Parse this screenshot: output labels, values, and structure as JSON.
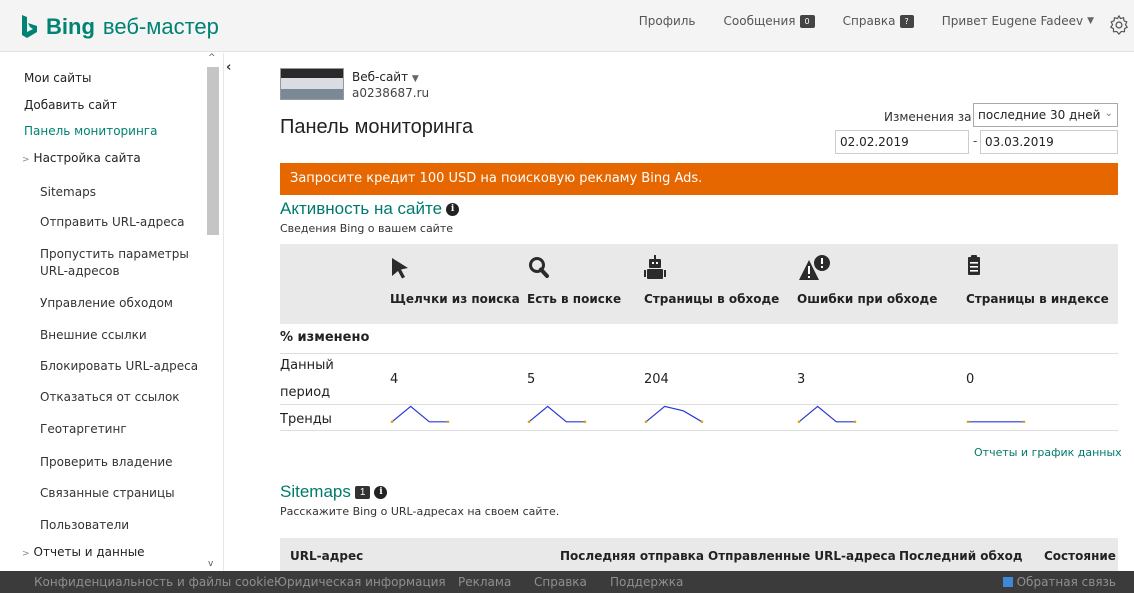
{
  "header": {
    "logo_text": "Bing",
    "logo_sub": "веб-мастер",
    "nav": [
      {
        "label": "Профиль"
      },
      {
        "label": "Сообщения",
        "badge": "0"
      },
      {
        "label": "Справка",
        "badge": "?"
      },
      {
        "label": "Привет Eugene Fadeev"
      }
    ],
    "settings_icon": "gear-icon"
  },
  "sidebar": {
    "items": [
      {
        "label": "Мои сайты"
      },
      {
        "label": "Добавить сайт"
      },
      {
        "label": "Панель мониторинга",
        "active": true
      },
      {
        "label": "Настройка сайта"
      },
      {
        "label": "Sitemaps"
      },
      {
        "label": "Отправить URL-адреса"
      },
      {
        "label": "Пропустить параметры"
      },
      {
        "label": "URL-адресов"
      },
      {
        "label": "Управление обходом"
      },
      {
        "label": "Внешние ссылки"
      },
      {
        "label": "Блокировать URL-адреса"
      },
      {
        "label": "Отказаться от ссылок"
      },
      {
        "label": "Геотаргетинг"
      },
      {
        "label": "Проверить владение"
      },
      {
        "label": "Связанные страницы"
      },
      {
        "label": "Пользователи"
      },
      {
        "label": "Отчеты и данные"
      }
    ]
  },
  "site": {
    "selector_label": "Веб-сайт",
    "url": "a0238687.ru"
  },
  "page": {
    "title": "Панель мониторинга",
    "change_label": "Изменения за",
    "period_selected": "последние 30 дней",
    "date_from": "02.02.2019",
    "date_sep": "-",
    "date_to": "03.03.2019"
  },
  "promo": {
    "text": "Запросите кредит 100 USD на поисковую рекламу Bing Ads."
  },
  "activity": {
    "title": "Активность на сайте",
    "subtitle": "Сведения Bing о вашем сайте",
    "metrics": [
      {
        "label": "Щелчки из поиска",
        "icon": "cursor-icon",
        "value": "4",
        "trend": [
          0.9,
          0.2,
          0.9,
          0.9
        ]
      },
      {
        "label": "Есть в поиске",
        "icon": "search-icon",
        "value": "5",
        "trend": [
          0.9,
          0.2,
          0.9,
          0.9
        ]
      },
      {
        "label": "Страницы в обходе",
        "icon": "robot-icon",
        "value": "204",
        "trend": [
          0.9,
          0.2,
          0.4,
          0.9
        ]
      },
      {
        "label": "Ошибки при обходе",
        "icon": "robot-error-icon",
        "value": "3",
        "trend": [
          0.9,
          0.2,
          0.9,
          0.9
        ]
      },
      {
        "label": "Страницы в индексе",
        "icon": "document-icon",
        "value": "0",
        "trend": [
          0.9,
          0.9,
          0.9,
          0.9
        ]
      }
    ],
    "row_change": "% изменено",
    "row_period_1": "Данный",
    "row_period_2": "период",
    "row_trends": "Тренды",
    "reports_link": "Отчеты и график данных"
  },
  "sitemaps": {
    "title": "Sitemaps",
    "count": "1",
    "subtitle": "Расскажите Bing о URL-адресах на своем сайте.",
    "columns": [
      "URL-адрес",
      "Последняя отправка",
      "Отправленные URL-адреса",
      "Последний обход",
      "Состояние"
    ]
  },
  "footer": {
    "links": [
      "Конфиденциальность и файлы cookie",
      "Юридическая информация",
      "Реклама",
      "Справка",
      "Поддержка"
    ],
    "feedback": "Обратная связь"
  },
  "colors": {
    "brand": "#008373",
    "promo": "#e66600",
    "trend_line": "#2a38d8",
    "trend_dot": "#e6a000"
  }
}
